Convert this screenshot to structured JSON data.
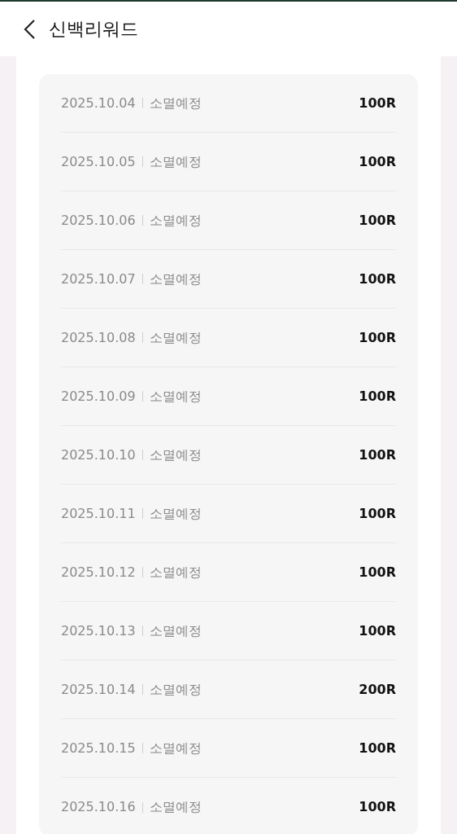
{
  "header": {
    "title": "신백리워드"
  },
  "rows": [
    {
      "date": "2025.10.04",
      "status": "소멸예정",
      "amount": "100R"
    },
    {
      "date": "2025.10.05",
      "status": "소멸예정",
      "amount": "100R"
    },
    {
      "date": "2025.10.06",
      "status": "소멸예정",
      "amount": "100R"
    },
    {
      "date": "2025.10.07",
      "status": "소멸예정",
      "amount": "100R"
    },
    {
      "date": "2025.10.08",
      "status": "소멸예정",
      "amount": "100R"
    },
    {
      "date": "2025.10.09",
      "status": "소멸예정",
      "amount": "100R"
    },
    {
      "date": "2025.10.10",
      "status": "소멸예정",
      "amount": "100R"
    },
    {
      "date": "2025.10.11",
      "status": "소멸예정",
      "amount": "100R"
    },
    {
      "date": "2025.10.12",
      "status": "소멸예정",
      "amount": "100R"
    },
    {
      "date": "2025.10.13",
      "status": "소멸예정",
      "amount": "100R"
    },
    {
      "date": "2025.10.14",
      "status": "소멸예정",
      "amount": "200R"
    },
    {
      "date": "2025.10.15",
      "status": "소멸예정",
      "amount": "100R"
    },
    {
      "date": "2025.10.16",
      "status": "소멸예정",
      "amount": "100R"
    }
  ]
}
